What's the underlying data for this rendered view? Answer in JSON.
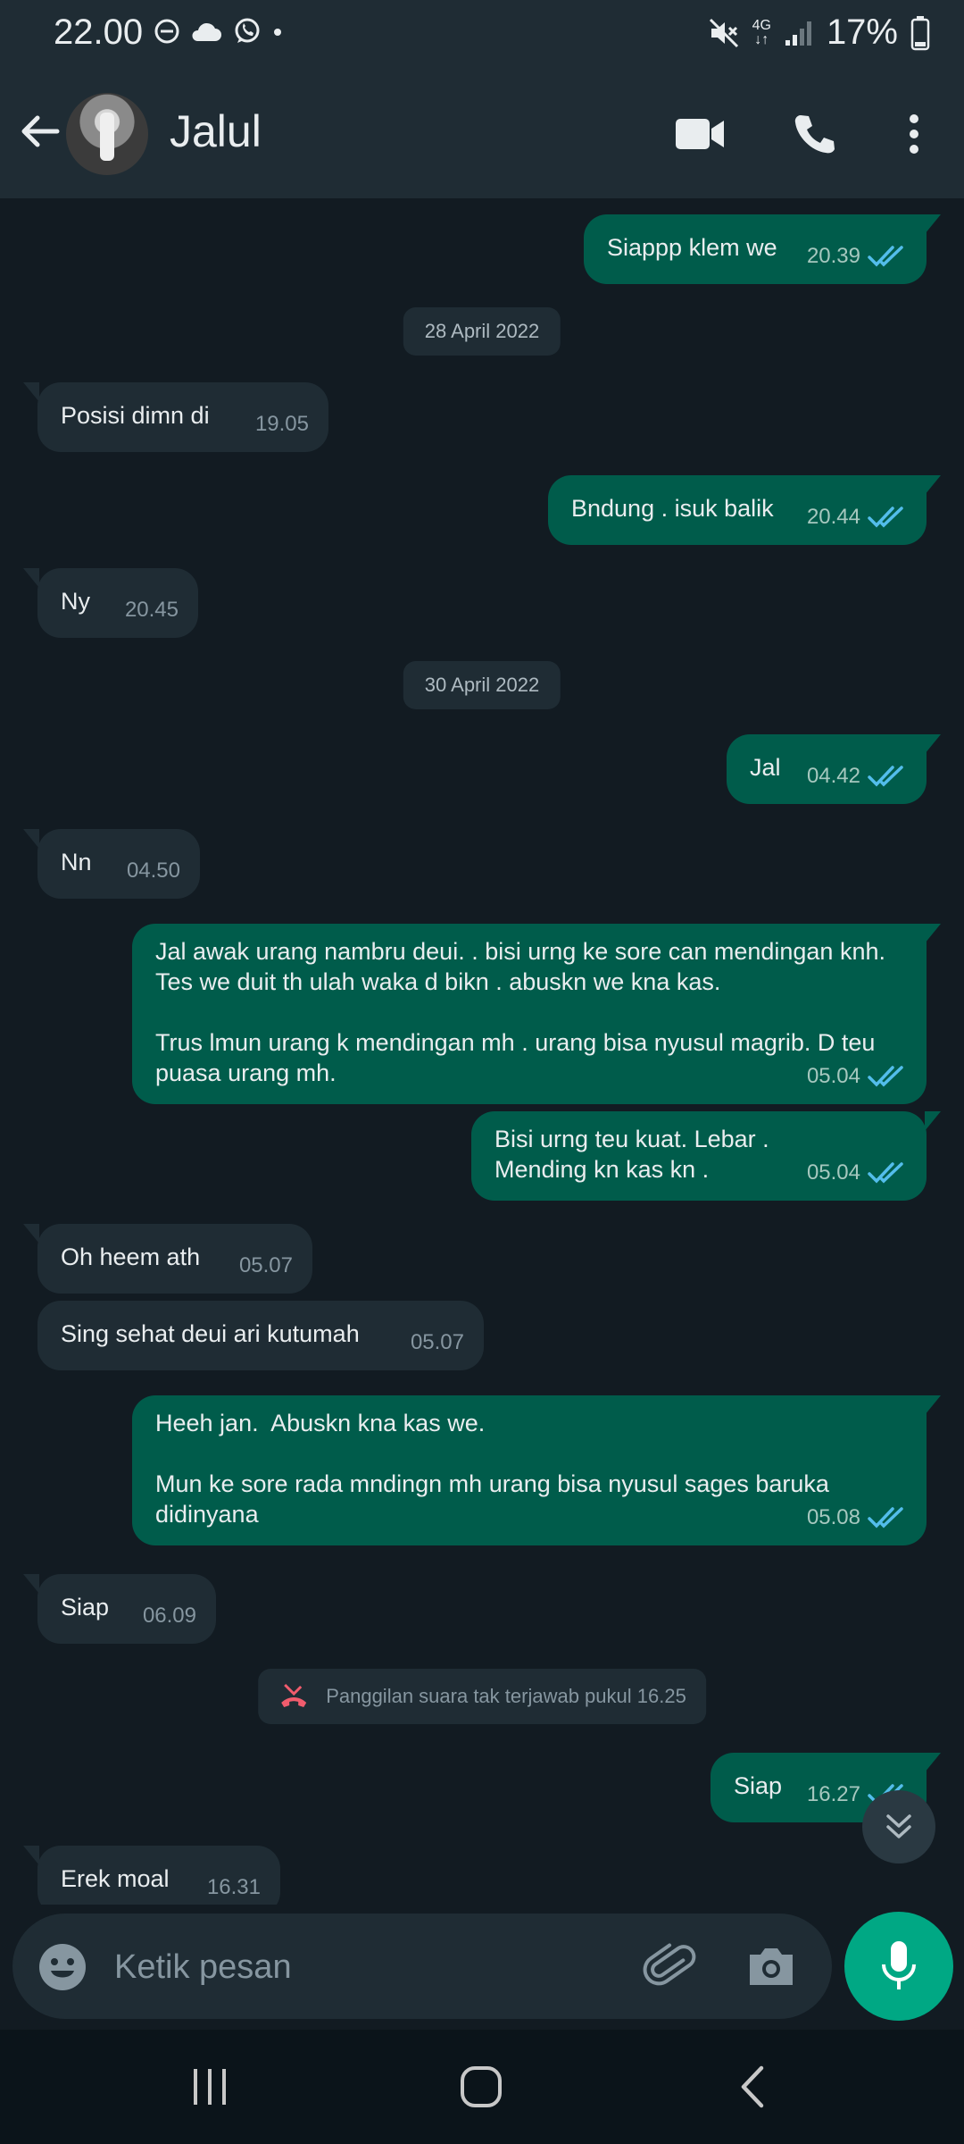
{
  "status_bar": {
    "time": "22.00",
    "battery": "17%",
    "network": "4G"
  },
  "header": {
    "contact_name": "Jalul"
  },
  "messages": [
    {
      "dir": "out",
      "text": "Siappp klem we",
      "time": "20.39",
      "read": true
    },
    {
      "type": "date",
      "text": "28 April 2022"
    },
    {
      "dir": "in",
      "text": "Posisi dimn di",
      "time": "19.05"
    },
    {
      "dir": "out",
      "text": "Bndung . isuk balik",
      "time": "20.44",
      "read": true
    },
    {
      "dir": "in",
      "text": "Ny",
      "time": "20.45"
    },
    {
      "type": "date",
      "text": "30 April 2022"
    },
    {
      "dir": "out",
      "text": "Jal",
      "time": "04.42",
      "read": true
    },
    {
      "dir": "in",
      "text": "Nn",
      "time": "04.50"
    },
    {
      "dir": "out",
      "text": "Jal awak urang nambru deui. . bisi urng ke sore can mendingan knh.   Tes we duit th ulah waka d bikn . abuskn we kna kas.\n\nTrus lmun urang k mendingan mh . urang bisa nyusul magrib. D teu puasa urang mh.",
      "time": "05.04",
      "read": true
    },
    {
      "dir": "out",
      "text": "Bisi urng teu kuat. Lebar .\nMending kn kas kn .",
      "time": "05.04",
      "read": true
    },
    {
      "dir": "in",
      "text": "Oh heem ath",
      "time": "05.07"
    },
    {
      "dir": "in",
      "text": "Sing sehat deui ari kutumah",
      "time": "05.07"
    },
    {
      "dir": "out",
      "text": "Heeh jan.  Abuskn kna kas we.\n\nMun ke sore rada mndingn mh urang bisa nyusul sages baruka didinyana",
      "time": "05.08",
      "read": true
    },
    {
      "dir": "in",
      "text": "Siap",
      "time": "06.09"
    },
    {
      "type": "call",
      "text": "Panggilan suara tak terjawab pukul 16.25"
    },
    {
      "dir": "out",
      "text": "Siap",
      "time": "16.27",
      "read": true
    },
    {
      "dir": "in",
      "text": "Erek moal",
      "time": "16.31"
    }
  ],
  "composer": {
    "placeholder": "Ketik pesan"
  },
  "icons": {
    "back": "arrow-left-icon",
    "video": "video-call-icon",
    "voice": "phone-icon",
    "menu": "more-vert-icon",
    "emoji": "emoji-icon",
    "attach": "paperclip-icon",
    "camera": "camera-icon",
    "mic": "mic-icon",
    "scroll": "double-chevron-down-icon"
  },
  "colors": {
    "background": "#121b22",
    "bar": "#1f2c34",
    "outgoing": "#005c4b",
    "incoming": "#1f2c34",
    "accent": "#00a884",
    "read_ticks": "#53bdeb",
    "missed_call": "#f15c6d"
  }
}
